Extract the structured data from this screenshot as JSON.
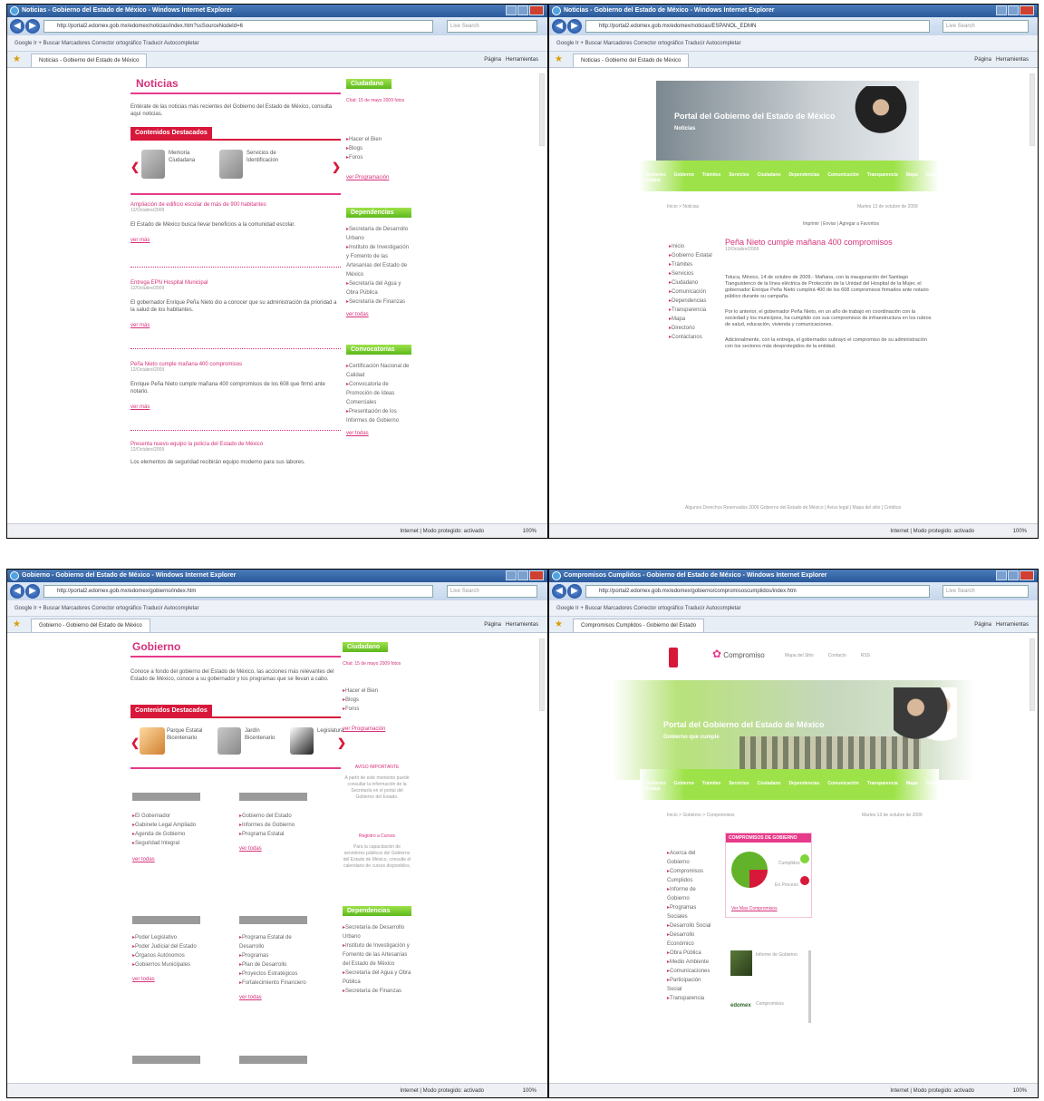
{
  "windows": [
    {
      "title": "Noticias - Gobierno del Estado de México - Windows Internet Explorer",
      "address": "http://portal2.edomex.gob.mx/edomex/noticias/index.htm?ssSourceNodeId=6",
      "tab": "Noticias - Gobierno del Estado de México",
      "page": {
        "heading": "Noticias",
        "intro": "Entérate de las noticias más recientes del Gobierno del Estado de México, consulta aquí noticias.",
        "featured_title": "Contenidos Destacados",
        "featured_items": [
          {
            "label": "Memoria Ciudadana"
          },
          {
            "label": "Servicios de Identificación"
          }
        ],
        "news": [
          {
            "title": "Ampliación de edificio escolar de más de 900 habitantes",
            "date": "12/Octubre/2009",
            "body": "El Estado de México busca llevar beneficios a la comunidad escolar.",
            "more": "ver más"
          },
          {
            "title": "Entrega EPN Hospital Municipal",
            "date": "12/Octubre/2009",
            "body": "El gobernador Enrique Peña Nieto dio a conocer que su administración da prioridad a la salud de los habitantes.",
            "more": "ver más"
          },
          {
            "title": "Peña Nieto cumple mañana 400 compromisos",
            "date": "12/Octubre/2009",
            "body": "Enrique Peña Nieto cumple mañana 400 compromisos de los 608 que firmó ante notario.",
            "more": "ver más"
          },
          {
            "title": "Presenta nuevo equipo la policía del Estado de México",
            "date": "12/Octubre/2009",
            "body": "Los elementos de seguridad recibirán equipo moderno para sus labores.",
            "more": "ver más"
          }
        ],
        "sidebar": {
          "ciudadano": "Ciudadano",
          "ciudadano_date": "Chat: 15 de mayo 2009 fotos",
          "ciudadano_links": [
            "Hacer el Bien",
            "Blogs",
            "Foros"
          ],
          "ciudadano_more": "ver Programación",
          "dependencias": "Dependencias",
          "dependencias_links": [
            "Secretaría de Desarrollo Urbano",
            "Instituto de Investigación y Fomento de las Artesanías del Estado de México",
            "Secretaría del Agua y Obra Pública",
            "Secretaría de Finanzas"
          ],
          "dependencias_more": "ver todas",
          "convocatorias": "Convocatorias",
          "convocatorias_links": [
            "Certificación Nacional de Calidad",
            "Convocatoria de Promoción de Ideas Comerciales",
            "Presentación de los Informes de Gobierno"
          ],
          "convocatorias_more": "ver todas"
        }
      },
      "status_zone": "Internet | Modo protegido: activado",
      "zoom": "100%"
    },
    {
      "title": "Noticias - Gobierno del Estado de México - Windows Internet Explorer",
      "address": "http://portal2.edomex.gob.mx/edomex/noticias/ESPANOL_EDMN",
      "tab": "Noticias - Gobierno del Estado de México",
      "page": {
        "banner_title": "Portal del Gobierno del Estado de México",
        "banner_sub": "Noticias",
        "nav": [
          "Inicio",
          "Gobierno Estatal",
          "Gobierno",
          "Trámites",
          "Servicios",
          "Ciudadano",
          "Dependencias",
          "Comunicación",
          "Transparencia",
          "Mapa",
          "Contáctanos"
        ],
        "breadcrumb": "Inicio > Noticias",
        "date": "Martes 13 de octubre de 2009",
        "tools": "Imprimir | Enviar | Agregar a Favoritos",
        "side_links": [
          "Inicio",
          "Gobierno Estatal",
          "Trámites",
          "Servicios",
          "Ciudadano",
          "Comunicación",
          "Dependencias",
          "Transparencia",
          "Mapa",
          "Directorio",
          "Contáctanos"
        ],
        "article_title": "Peña Nieto cumple mañana 400 compromisos",
        "article_date": "12/Octubre/2009",
        "paragraphs": [
          "Toluca, México, 14 de octubre de 2009.- Mañana, con la inauguración del Santiago Tianguistenco de la línea eléctrica de Protección de la Unidad del Hospital de la Mujer, el gobernador Enrique Peña Nieto cumplirá 400 de los 608 compromisos firmados ante notario público durante su campaña.",
          "Por lo anterior, el gobernador Peña Nieto, en un año de trabajo en coordinación con la sociedad y los municipios, ha cumplido con sus compromisos de infraestructura en los rubros de salud, educación, vivienda y comunicaciones.",
          "Adicionalmente, con la entrega, el gobernador subrayó el compromiso de su administración con los sectores más desprotegidos de la entidad."
        ],
        "footer": "Algunos Derechos Reservados 2009 Gobierno del Estado de México | Aviso legal | Mapa del sitio | Créditos"
      },
      "status_zone": "Internet | Modo protegido: activado",
      "zoom": "100%"
    },
    {
      "title": "Gobierno - Gobierno del Estado de México - Windows Internet Explorer",
      "address": "http://portal2.edomex.gob.mx/edomex/gobierno/index.htm",
      "tab": "Gobierno - Gobierno del Estado de México",
      "page": {
        "heading": "Gobierno",
        "intro": "Conoce a fondo del gobierno del Estado de México, las acciones más relevantes del Estado de México, conoce a su gobernador y los programas que se llevan a cabo.",
        "featured_title": "Contenidos Destacados",
        "featured_items": [
          {
            "label": "Parque Estatal Bicentenario"
          },
          {
            "label": "Jardín Bicentenario"
          },
          {
            "label": "Legislatura"
          }
        ],
        "sections": [
          {
            "links": [
              "El Gobernador",
              "Gabinete Legal Ampliado",
              "Agenda de Gobierno",
              "Seguridad Integral"
            ],
            "more": "ver todas"
          },
          {
            "links": [
              "Gobierno del Estado",
              "Informes de Gobierno",
              "Programa Estatal"
            ],
            "more": "ver todas"
          },
          {
            "links": [
              "Poder Legislativo",
              "Poder Judicial del Estado",
              "Órganos Autónomos",
              "Gobiernos Municipales"
            ],
            "more": "ver todas"
          },
          {
            "links": [
              "Programa Estatal de Desarrollo",
              "Programas",
              "Plan de Desarrollo",
              "Proyectos Estratégicos",
              "Fortalecimiento Financiero"
            ],
            "more": "ver todas"
          }
        ],
        "sidebar": {
          "ciudadano": "Ciudadano",
          "ciudadano_date": "Chat: 15 de mayo 2009 fotos",
          "ciudadano_links": [
            "Hacer el Bien",
            "Blogs",
            "Foros"
          ],
          "ciudadano_more": "ver Programación",
          "aviso_title": "AVISO IMPORTANTE",
          "aviso_body": "A partir de este momento puede consultar la información de la Secretaría en el portal del Gobierno del Estado.",
          "registro_title": "Registro a Cursos",
          "registro_body": "Para la capacitación de servidores públicos del Gobierno del Estado de México, consulte el calendario de cursos disponibles.",
          "dependencias": "Dependencias",
          "dependencias_links": [
            "Secretaría de Desarrollo Urbano",
            "Instituto de Investigación y Fomento de las Artesanías del Estado de México",
            "Secretaría del Agua y Obra Pública",
            "Secretaría de Finanzas"
          ]
        }
      },
      "status_zone": "Internet | Modo protegido: activado",
      "zoom": "100%"
    },
    {
      "title": "Compromisos Cumplidos - Gobierno del Estado de México - Windows Internet Explorer",
      "address": "http://portal2.edomex.gob.mx/edomex/gobierno/compromisoscumplidos/index.htm",
      "tab": "Compromisos Cumplidos - Gobierno del Estado",
      "page": {
        "logo_text": "Compromiso",
        "top_links": [
          "Mapa del Sitio",
          "Contacto",
          "RSS"
        ],
        "banner_title": "Portal del Gobierno del Estado de México",
        "banner_sub": "Gobierno que cumple",
        "nav": [
          "Inicio",
          "Gobierno Estatal",
          "Gobierno",
          "Trámites",
          "Servicios",
          "Ciudadano",
          "Dependencias",
          "Comunicación",
          "Transparencia",
          "Mapa",
          "Contáctanos"
        ],
        "breadcrumb": "Inicio > Gobierno > Compromisos",
        "date": "Martes 13 de octubre de 2009",
        "box_title": "COMPROMISOS DE GOBIERNO",
        "chart_labels": [
          "Cumplidos",
          "En Proceso"
        ],
        "chart_link": "Ver Mas Compromisos",
        "side_links": [
          "Acerca del Gobierno",
          "Compromisos Cumplidos",
          "Informe de Gobierno",
          "Programas Sociales",
          "Desarrollo Social",
          "Desarrollo Económico",
          "Obra Pública",
          "Medio Ambiente",
          "Comunicaciones",
          "Participación Social",
          "Transparencia"
        ],
        "lower_items": [
          "Informe de Gobierno",
          "Compromisos"
        ],
        "lower_badge": "edomex"
      },
      "status_zone": "Internet | Modo protegido: activado",
      "zoom": "100%"
    }
  ],
  "browser": {
    "search_placeholder": "Live Search",
    "toolbar": "Google   Ir  +  Buscar  Marcadores  Corrector ortográfico  Traducir  Autocompletar",
    "page_menu": "Página",
    "tools_menu": "Herramientas"
  },
  "colors": {
    "accent_pink": "#d6307a",
    "green": "#7ed63a",
    "red": "#d8183a",
    "ie_blue": "#2a5a9a"
  }
}
